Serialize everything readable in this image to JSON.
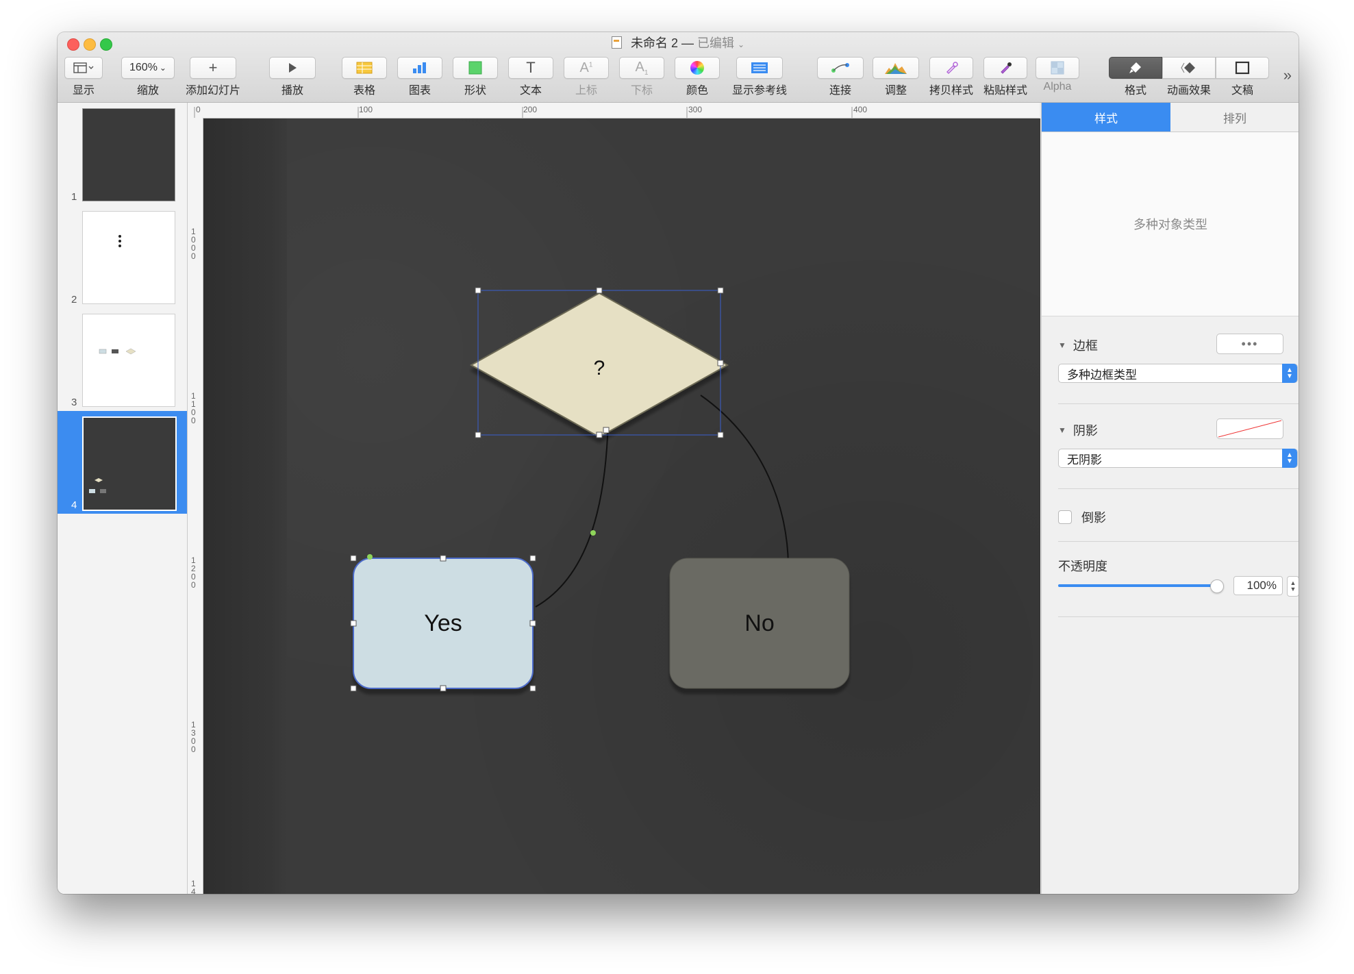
{
  "window": {
    "title": "未命名 2",
    "title_sep": " — ",
    "title_status": "已编辑"
  },
  "toolbar": {
    "view_label": "显示",
    "zoom_value": "160%",
    "zoom_label": "缩放",
    "add_slide_label": "添加幻灯片",
    "play_label": "播放",
    "table_label": "表格",
    "chart_label": "图表",
    "shape_label": "形状",
    "text_label": "文本",
    "superscript_label": "上标",
    "subscript_label": "下标",
    "color_label": "颜色",
    "guides_label": "显示参考线",
    "connect_label": "连接",
    "adjust_label": "调整",
    "copy_style_label": "拷贝样式",
    "paste_style_label": "粘贴样式",
    "alpha_label": "Alpha",
    "format_label": "格式",
    "animate_label": "动画效果",
    "document_label": "文稿",
    "more_icon": "»"
  },
  "navigator": {
    "slides": [
      {
        "number": "1"
      },
      {
        "number": "2"
      },
      {
        "number": "3"
      },
      {
        "number": "4",
        "selected": true
      }
    ]
  },
  "ruler": {
    "h_ticks": [
      "0",
      "100",
      "200",
      "300",
      "400"
    ],
    "v_ticks": [
      "1000",
      "1100",
      "1200",
      "1300",
      "14"
    ]
  },
  "canvas": {
    "decision_label": "?",
    "yes_label": "Yes",
    "no_label": "No",
    "colors": {
      "background": "#3b3b3b",
      "decision_fill": "#e6e0c4",
      "yes_fill": "#cddde3",
      "no_fill": "#6a6a64",
      "selection": "#3a5fcf",
      "connector_handle": "#8ed45a"
    }
  },
  "inspector": {
    "tab_style": "样式",
    "tab_arrange": "排列",
    "preview_text": "多种对象类型",
    "border_title": "边框",
    "border_select": "多种边框类型",
    "shadow_title": "阴影",
    "shadow_select": "无阴影",
    "reflection_label": "倒影",
    "opacity_title": "不透明度",
    "opacity_value": "100%",
    "opacity_fraction": 1.0
  }
}
